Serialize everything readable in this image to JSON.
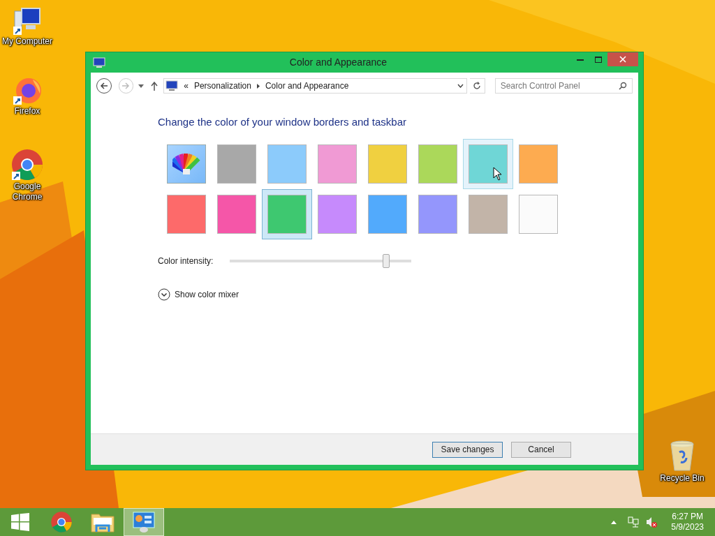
{
  "desktop_icons": [
    {
      "kind": "computer",
      "label": "My Computer"
    },
    {
      "kind": "firefox",
      "label": "Firefox"
    },
    {
      "kind": "chrome",
      "label": "Google Chrome"
    },
    {
      "kind": "recycle",
      "label": "Recycle Bin"
    }
  ],
  "window": {
    "title": "Color and Appearance",
    "breadcrumb": [
      "«",
      "Personalization",
      "Color and Appearance"
    ],
    "search": {
      "placeholder": "Search Control Panel"
    },
    "heading": "Change the color of your window borders and taskbar",
    "swatches": [
      {
        "kind": "palette",
        "selected": false,
        "hovered": false
      },
      {
        "kind": "color",
        "color": "#a8a8a8",
        "selected": false,
        "hovered": false
      },
      {
        "kind": "color",
        "color": "#8ccbfb",
        "selected": false,
        "hovered": false
      },
      {
        "kind": "color",
        "color": "#f09ad4",
        "selected": false,
        "hovered": false
      },
      {
        "kind": "color",
        "color": "#f0d040",
        "selected": false,
        "hovered": false
      },
      {
        "kind": "color",
        "color": "#abd85a",
        "selected": false,
        "hovered": false
      },
      {
        "kind": "color",
        "color": "#6fd6d6",
        "selected": false,
        "hovered": true
      },
      {
        "kind": "color",
        "color": "#fdab50",
        "selected": false,
        "hovered": false
      },
      {
        "kind": "color",
        "color": "#fd6a6a",
        "selected": false,
        "hovered": false
      },
      {
        "kind": "color",
        "color": "#f556a8",
        "selected": false,
        "hovered": false
      },
      {
        "kind": "color",
        "color": "#3ec870",
        "selected": true,
        "hovered": false
      },
      {
        "kind": "color",
        "color": "#c68afc",
        "selected": false,
        "hovered": false
      },
      {
        "kind": "color",
        "color": "#52aafc",
        "selected": false,
        "hovered": false
      },
      {
        "kind": "color",
        "color": "#9496fc",
        "selected": false,
        "hovered": false
      },
      {
        "kind": "color",
        "color": "#c2b4a8",
        "selected": false,
        "hovered": false
      },
      {
        "kind": "color",
        "color": "#fbfbfb",
        "selected": false,
        "hovered": false
      }
    ],
    "intensity": {
      "label": "Color intensity:",
      "level": 0.86
    },
    "mixer": {
      "label": "Show color mixer",
      "expanded": false
    },
    "buttons": [
      "Save changes",
      "Cancel"
    ]
  },
  "taskbar": {
    "items": [
      {
        "kind": "start",
        "selected": false
      },
      {
        "kind": "chrome",
        "selected": false
      },
      {
        "kind": "explorer",
        "selected": false
      },
      {
        "kind": "control",
        "selected": true
      }
    ],
    "time": "6:27 PM",
    "date": "5/9/2023"
  }
}
